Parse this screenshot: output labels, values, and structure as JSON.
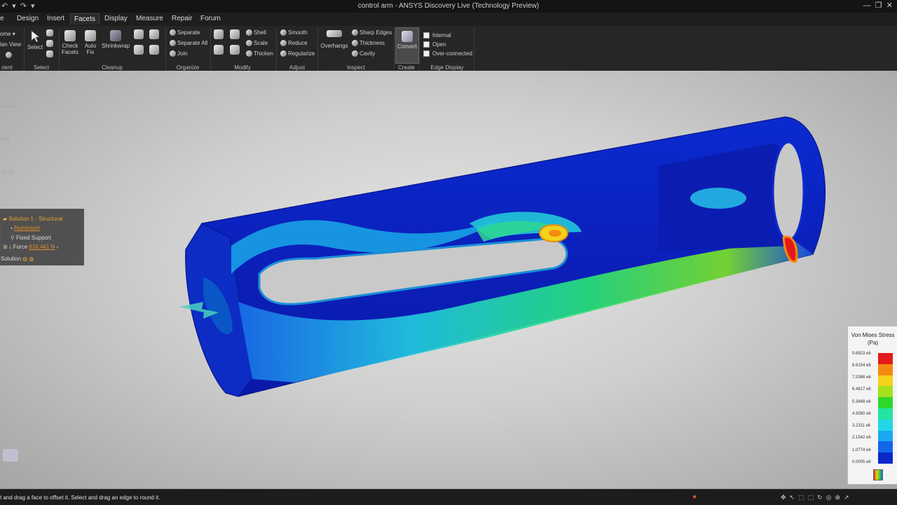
{
  "app": {
    "title": "control arm - ANSYS Discovery Live (Technology Preview)"
  },
  "menu": {
    "items": [
      "e",
      "Design",
      "Insert",
      "Facets",
      "Display",
      "Measure",
      "Repair",
      "Forum"
    ],
    "active": "Facets"
  },
  "ribbon": {
    "orient": {
      "home": "ome",
      "plan_view": "lan View",
      "label": "rient"
    },
    "select_group": {
      "select": "Select",
      "label": "Select"
    },
    "cleanup": {
      "check_facets_1": "Check",
      "check_facets_2": "Facets",
      "auto_fix_1": "Auto",
      "auto_fix_2": "Fix",
      "shrinkwrap": "Shrinkwrap",
      "label": "Cleanup"
    },
    "organize": {
      "separate": "Separate",
      "separate_all": "Separate All",
      "join": "Join",
      "label": "Organize"
    },
    "modify": {
      "shell": "Shell",
      "scale": "Scale",
      "thicken": "Thicken",
      "label": "Modify"
    },
    "adjust": {
      "smooth": "Smooth",
      "reduce": "Reduce",
      "regularize": "Regularize",
      "label": "Adjust"
    },
    "inspect": {
      "overhangs": "Overhangs",
      "sharp_edges": "Sharp Edges",
      "thickness": "Thickness",
      "cavity": "Cavity",
      "label": "Inspect"
    },
    "create": {
      "convert": "Convert",
      "label": "Create"
    },
    "edge_display": {
      "internal": "Internal",
      "open": "Open",
      "over_connected": "Over-connected",
      "label": "Edge Display"
    }
  },
  "left_tools": [
    "Sketch",
    "Edit",
    "Setup"
  ],
  "tree": {
    "solution": "Solution 1 - Structural",
    "material": "Aluminium",
    "support": "Fixed Support",
    "force_label": "Force",
    "force_value": "616.441 N",
    "solution_row": "Solution"
  },
  "legend": {
    "title": "Von Mises Stress",
    "unit": "(Pa)",
    "values": [
      "9.6923 e6",
      "8.6154 e6",
      "7.5386 e6",
      "6.4617 e6",
      "5.3848 e6",
      "4.3080 e6",
      "3.2311 e6",
      "2.1542 e6",
      "1.0774 e6",
      "0.0005 e6"
    ],
    "colors": [
      "#e41a1a",
      "#f58a10",
      "#f2d21a",
      "#a6e01e",
      "#2ed82a",
      "#22e6a0",
      "#22d6e6",
      "#1aa8f0",
      "#1466e8",
      "#0a28c8"
    ]
  },
  "status": {
    "message": "t and drag a face to offset it. Select and drag an edge to round it."
  }
}
